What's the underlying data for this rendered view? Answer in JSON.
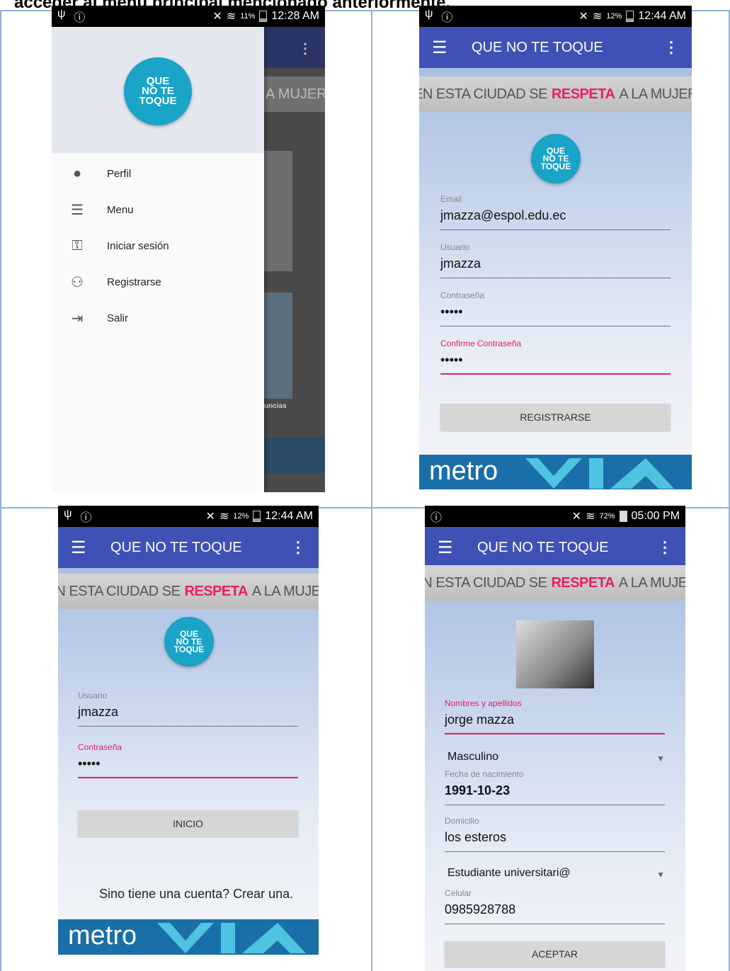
{
  "doc": {
    "heading": "acceder al menú principal mencionado anteriormente."
  },
  "app": {
    "title": "QUE NO TE TOQUE",
    "logo_text": "QUE NO TE TOQUE",
    "banner": {
      "pre": "EN ESTA CIUDAD SE",
      "highlight": "RESPETA",
      "post": "A LA MUJER"
    },
    "metro_word": "metro",
    "accent_color": "#e91e63",
    "primary_color": "#3f51b5"
  },
  "screen1": {
    "status": {
      "pct": "11%",
      "time": "12:28 AM"
    },
    "drawer": {
      "items": [
        {
          "label": "Perfil",
          "icon": "person-icon"
        },
        {
          "label": "Menu",
          "icon": "list-icon"
        },
        {
          "label": "Iniciar sesión",
          "icon": "key-icon"
        },
        {
          "label": "Registrarse",
          "icon": "add-group-icon"
        },
        {
          "label": "Salir",
          "icon": "exit-icon"
        }
      ]
    },
    "behind_banner": "A MUJER",
    "behind_text": "uncias"
  },
  "screen2": {
    "status": {
      "pct": "12%",
      "time": "12:44 AM"
    },
    "fields": {
      "email": {
        "label": "Email",
        "value": "jmazza@espol.edu.ec"
      },
      "usuario": {
        "label": "Usuario",
        "value": "jmazza"
      },
      "password": {
        "label": "Contraseña",
        "value": "•••••"
      },
      "confirm": {
        "label": "Confirme Contraseña",
        "value": "•••••"
      }
    },
    "button": "REGISTRARSE"
  },
  "screen3": {
    "status": {
      "pct": "12%",
      "time": "12:44 AM"
    },
    "fields": {
      "usuario": {
        "label": "Usuario",
        "value": "jmazza"
      },
      "password": {
        "label": "Contraseña",
        "value": "•••••"
      }
    },
    "button": "INICIO",
    "link": "Sino tiene una cuenta? Crear una."
  },
  "screen4": {
    "status": {
      "pct": "72%",
      "time": "05:00 PM"
    },
    "fields": {
      "nombres": {
        "label": "Nombres y apellidos",
        "value": "jorge mazza"
      },
      "genero": {
        "value": "Masculino"
      },
      "fecha": {
        "label": "Fecha de nacimiento",
        "value": "1991-10-23"
      },
      "domicilio": {
        "label": "Domicilio",
        "value": "los esteros"
      },
      "ocupacion": {
        "value": "Estudiante universitari@"
      },
      "celular": {
        "label": "Celular",
        "value": "0985928788"
      }
    },
    "button": "ACEPTAR"
  }
}
